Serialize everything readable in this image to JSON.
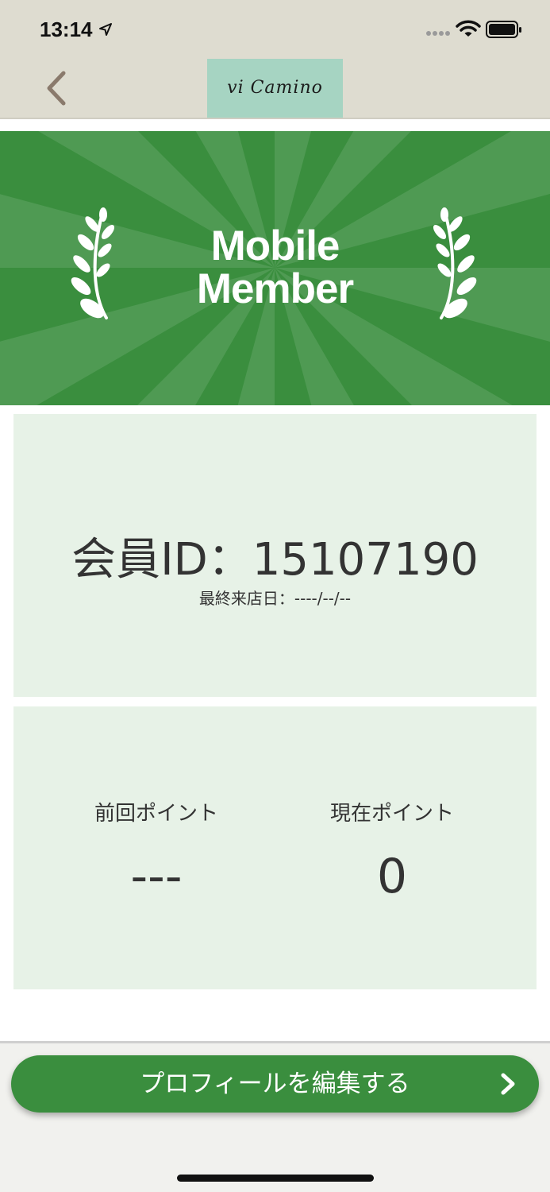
{
  "status_bar": {
    "time": "13:14",
    "icons": [
      "location-arrow-icon",
      "signal-dots-icon",
      "wifi-icon",
      "battery-icon"
    ]
  },
  "nav": {
    "back_icon": "chevron-left-icon",
    "logo_text": "vi Camino"
  },
  "banner": {
    "line1": "Mobile",
    "line2": "Member",
    "decoration": "laurel-branch-icon"
  },
  "member": {
    "id_text": "会員ID：15107190",
    "last_visit": "最終来店日：----/--/--"
  },
  "points": {
    "previous_label": "前回ポイント",
    "previous_value": "---",
    "current_label": "現在ポイント",
    "current_value": "0"
  },
  "cta": {
    "label": "プロフィールを編集する",
    "icon": "chevron-right-icon"
  },
  "colors": {
    "accent_green": "#3a8e3e",
    "card_bg": "#e7f2e7",
    "header_bg": "#dedcd0",
    "logo_bg": "#a6d4c2"
  }
}
